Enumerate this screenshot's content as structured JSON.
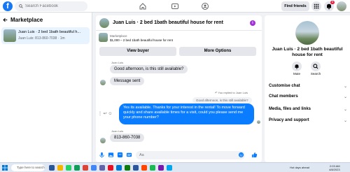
{
  "topbar": {
    "logo": "f",
    "search_placeholder": "Search Facebook",
    "find_friends_label": "Find friends",
    "notifications_count": "8"
  },
  "sidebar": {
    "title": "Marketplace",
    "conversation": {
      "title": "Juan Luis · 2 bed 1bath beautiful h...",
      "subtitle": "Juan Luis: 813-860-7038 · 1m"
    }
  },
  "chat": {
    "header_title": "Juan Luis · 2 bed 1bath beautiful house for rent",
    "marketplace_label": "Marketplace",
    "listing_line": "$1,000 – 2 bed 1bath beautiful house for rent",
    "view_buyer_label": "View buyer",
    "more_options_label": "More Options",
    "messages": [
      {
        "sender": "Juan Luis",
        "text": "Good afternoon, is this still available?"
      },
      {
        "text": "Message sent"
      }
    ],
    "reply_note": "You replied to Juan Luis",
    "quoted_text": "Good afternoon, is this still available?",
    "outgoing_text": "Yes its available. Thanks for your interest in the rental! To move forward quickly and share available times for a visit, could you please send me your phone number?",
    "last_sender": "Juan Luis",
    "last_message": "813-860-7038",
    "composer_placeholder": "Aa"
  },
  "details": {
    "title": "Juan Luis · 2 bed 1bath beautiful house for rent",
    "mute_label": "Mute",
    "search_label": "Search",
    "sections": [
      "Customise chat",
      "Chat members",
      "Media, files and links",
      "Privacy and support"
    ]
  },
  "taskbar": {
    "search_placeholder": "Type here to search",
    "weather": "Hot days ahead",
    "time": "2:03 AM",
    "date": "4/8/2023"
  },
  "colors": {
    "brand": "#1877f2",
    "outgoing_bubble": "#0a7cff",
    "incoming_bubble": "#e4e6eb"
  }
}
